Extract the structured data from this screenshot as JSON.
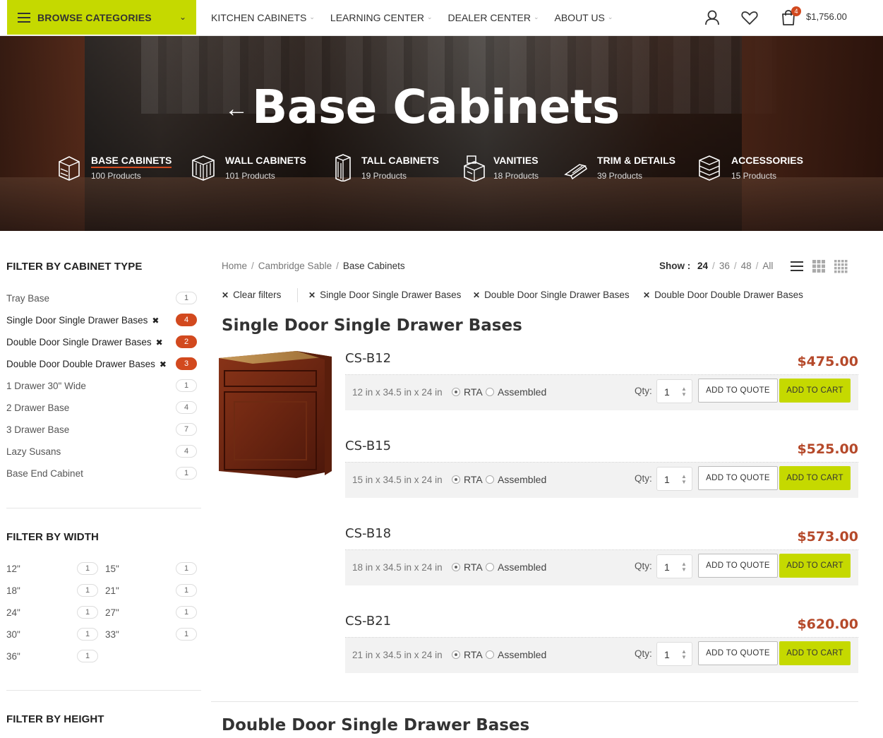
{
  "header": {
    "browse_label": "BROWSE CATEGORIES",
    "nav": [
      "KITCHEN CABINETS",
      "LEARNING CENTER",
      "DEALER CENTER",
      "ABOUT US"
    ],
    "cart_count": "4",
    "cart_total": "$1,756.00",
    "accent_color": "#c5d900"
  },
  "hero": {
    "title": "Base Cabinets",
    "categories": [
      {
        "name": "BASE CABINETS",
        "count": "100 Products",
        "icon": "base-cabinet-icon"
      },
      {
        "name": "WALL CABINETS",
        "count": "101 Products",
        "icon": "wall-cabinet-icon"
      },
      {
        "name": "TALL CABINETS",
        "count": "19 Products",
        "icon": "tall-cabinet-icon"
      },
      {
        "name": "VANITIES",
        "count": "18 Products",
        "icon": "vanity-icon"
      },
      {
        "name": "TRIM & DETAILS",
        "count": "39 Products",
        "icon": "trim-icon"
      },
      {
        "name": "ACCESSORIES",
        "count": "15 Products",
        "icon": "accessories-icon"
      }
    ]
  },
  "sidebar": {
    "type_title": "FILTER BY CABINET TYPE",
    "types": [
      {
        "label": "Tray Base",
        "count": "1",
        "selected": false
      },
      {
        "label": "Single Door Single Drawer Bases",
        "count": "4",
        "selected": true
      },
      {
        "label": "Double Door Single Drawer Bases",
        "count": "2",
        "selected": true
      },
      {
        "label": "Double Door Double Drawer Bases",
        "count": "3",
        "selected": true
      },
      {
        "label": "1 Drawer 30\" Wide",
        "count": "1",
        "selected": false
      },
      {
        "label": "2 Drawer Base",
        "count": "4",
        "selected": false
      },
      {
        "label": "3 Drawer Base",
        "count": "7",
        "selected": false
      },
      {
        "label": "Lazy Susans",
        "count": "4",
        "selected": false
      },
      {
        "label": "Base End Cabinet",
        "count": "1",
        "selected": false
      }
    ],
    "width_title": "FILTER BY WIDTH",
    "widths": [
      {
        "label": "12\"",
        "count": "1"
      },
      {
        "label": "15\"",
        "count": "1"
      },
      {
        "label": "18\"",
        "count": "1"
      },
      {
        "label": "21\"",
        "count": "1"
      },
      {
        "label": "24\"",
        "count": "1"
      },
      {
        "label": "27\"",
        "count": "1"
      },
      {
        "label": "30\"",
        "count": "1"
      },
      {
        "label": "33\"",
        "count": "1"
      },
      {
        "label": "36\"",
        "count": "1"
      }
    ],
    "height_title": "FILTER BY HEIGHT"
  },
  "breadcrumb": {
    "items": [
      "Home",
      "Cambridge Sable"
    ],
    "current": "Base Cabinets"
  },
  "show": {
    "label": "Show :",
    "options": [
      "24",
      "36",
      "48",
      "All"
    ],
    "selected": "24"
  },
  "active_filters": {
    "clear": "Clear filters",
    "chips": [
      "Single Door Single Drawer Bases",
      "Double Door Single Drawer Bases",
      "Double Door Double Drawer Bases"
    ]
  },
  "sections": [
    {
      "title": "Single Door Single Drawer Bases"
    },
    {
      "title": "Double Door Single Drawer Bases"
    }
  ],
  "product_labels": {
    "rta": "RTA",
    "assembled": "Assembled",
    "qty": "Qty:",
    "quote": "ADD TO QUOTE",
    "cart": "ADD TO CART"
  },
  "products": [
    {
      "sku": "CS-B12",
      "price": "$475.00",
      "dims": "12 in x 34.5 in x 24 in",
      "qty": "1"
    },
    {
      "sku": "CS-B15",
      "price": "$525.00",
      "dims": "15 in x 34.5 in x 24 in",
      "qty": "1"
    },
    {
      "sku": "CS-B18",
      "price": "$573.00",
      "dims": "18 in x 34.5 in x 24 in",
      "qty": "1"
    },
    {
      "sku": "CS-B21",
      "price": "$620.00",
      "dims": "21 in x 34.5 in x 24 in",
      "qty": "1"
    }
  ]
}
